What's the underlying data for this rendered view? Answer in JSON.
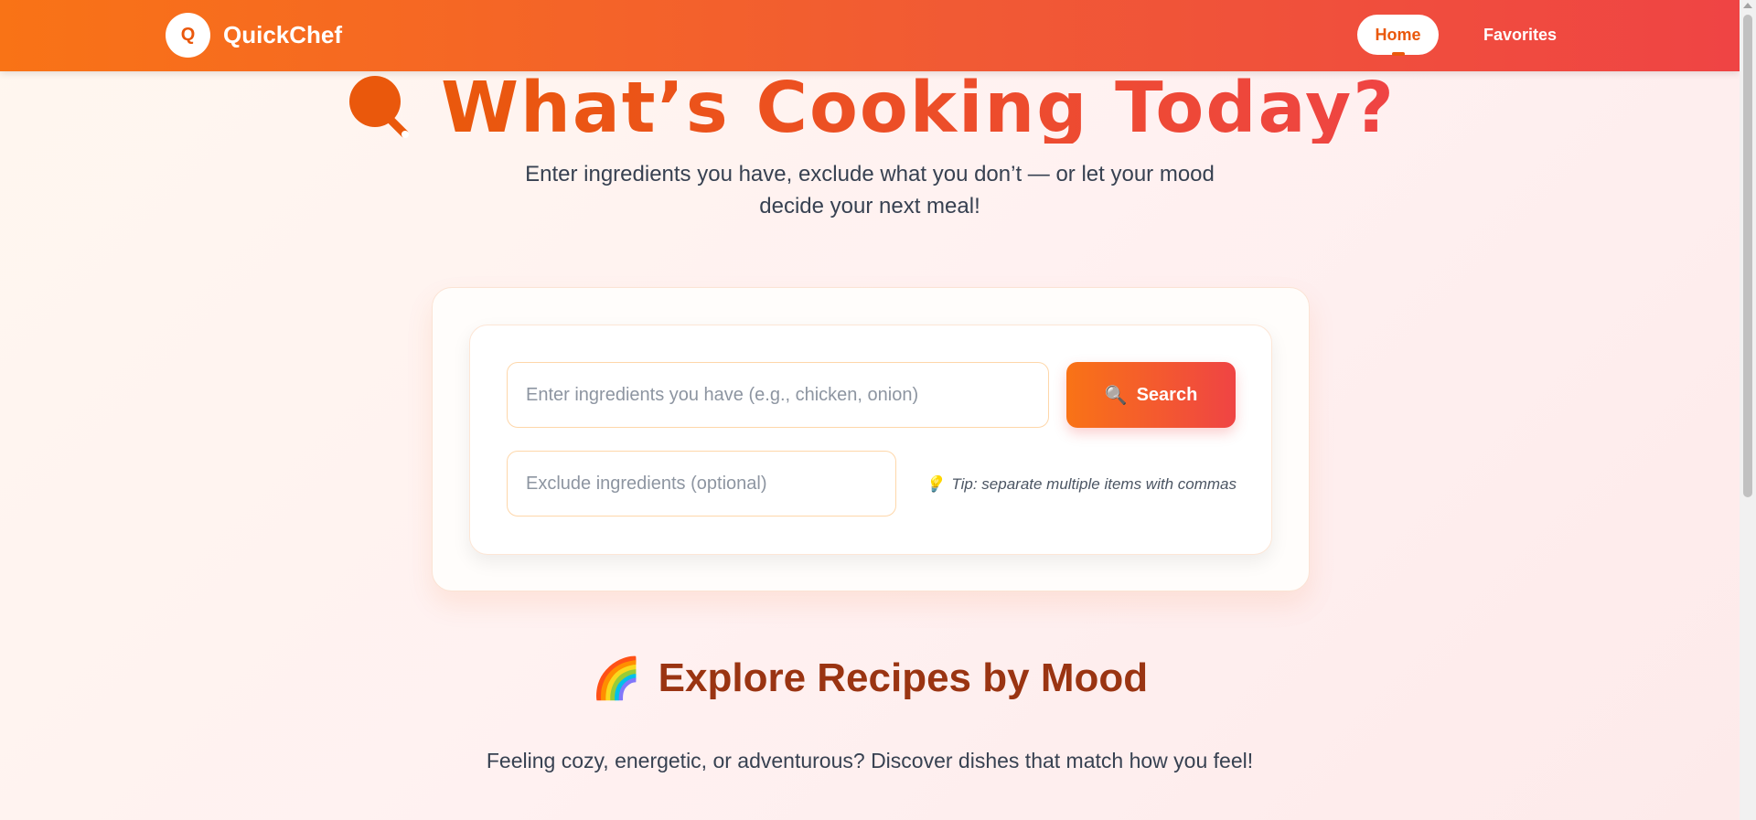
{
  "navbar": {
    "logo_letter": "Q",
    "brand": "QuickChef",
    "links": [
      {
        "label": "Home",
        "active": true
      },
      {
        "label": "Favorites",
        "active": false
      }
    ]
  },
  "hero": {
    "title": "What’s Cooking Today?",
    "subtitle": "Enter ingredients you have, exclude what you don’t — or let your mood decide your next meal!",
    "title_icon": "magnifier-icon"
  },
  "search": {
    "ingredients_placeholder": "Enter ingredients you have (e.g., chicken, onion)",
    "ingredients_value": "",
    "exclude_placeholder": "Exclude ingredients (optional)",
    "exclude_value": "",
    "button_icon": "🔍",
    "button_label": "Search",
    "tip_icon": "💡",
    "tip": "Tip: separate multiple items with commas"
  },
  "mood": {
    "icon": "🌈",
    "title": "Explore Recipes by Mood",
    "subtitle": "Feeling cozy, energetic, or adventurous? Discover dishes that match how you feel!"
  },
  "colors": {
    "brand_orange": "#f97316",
    "brand_red": "#ef4444",
    "accent_dark": "#ea580c",
    "mood_title": "#9a3412"
  }
}
